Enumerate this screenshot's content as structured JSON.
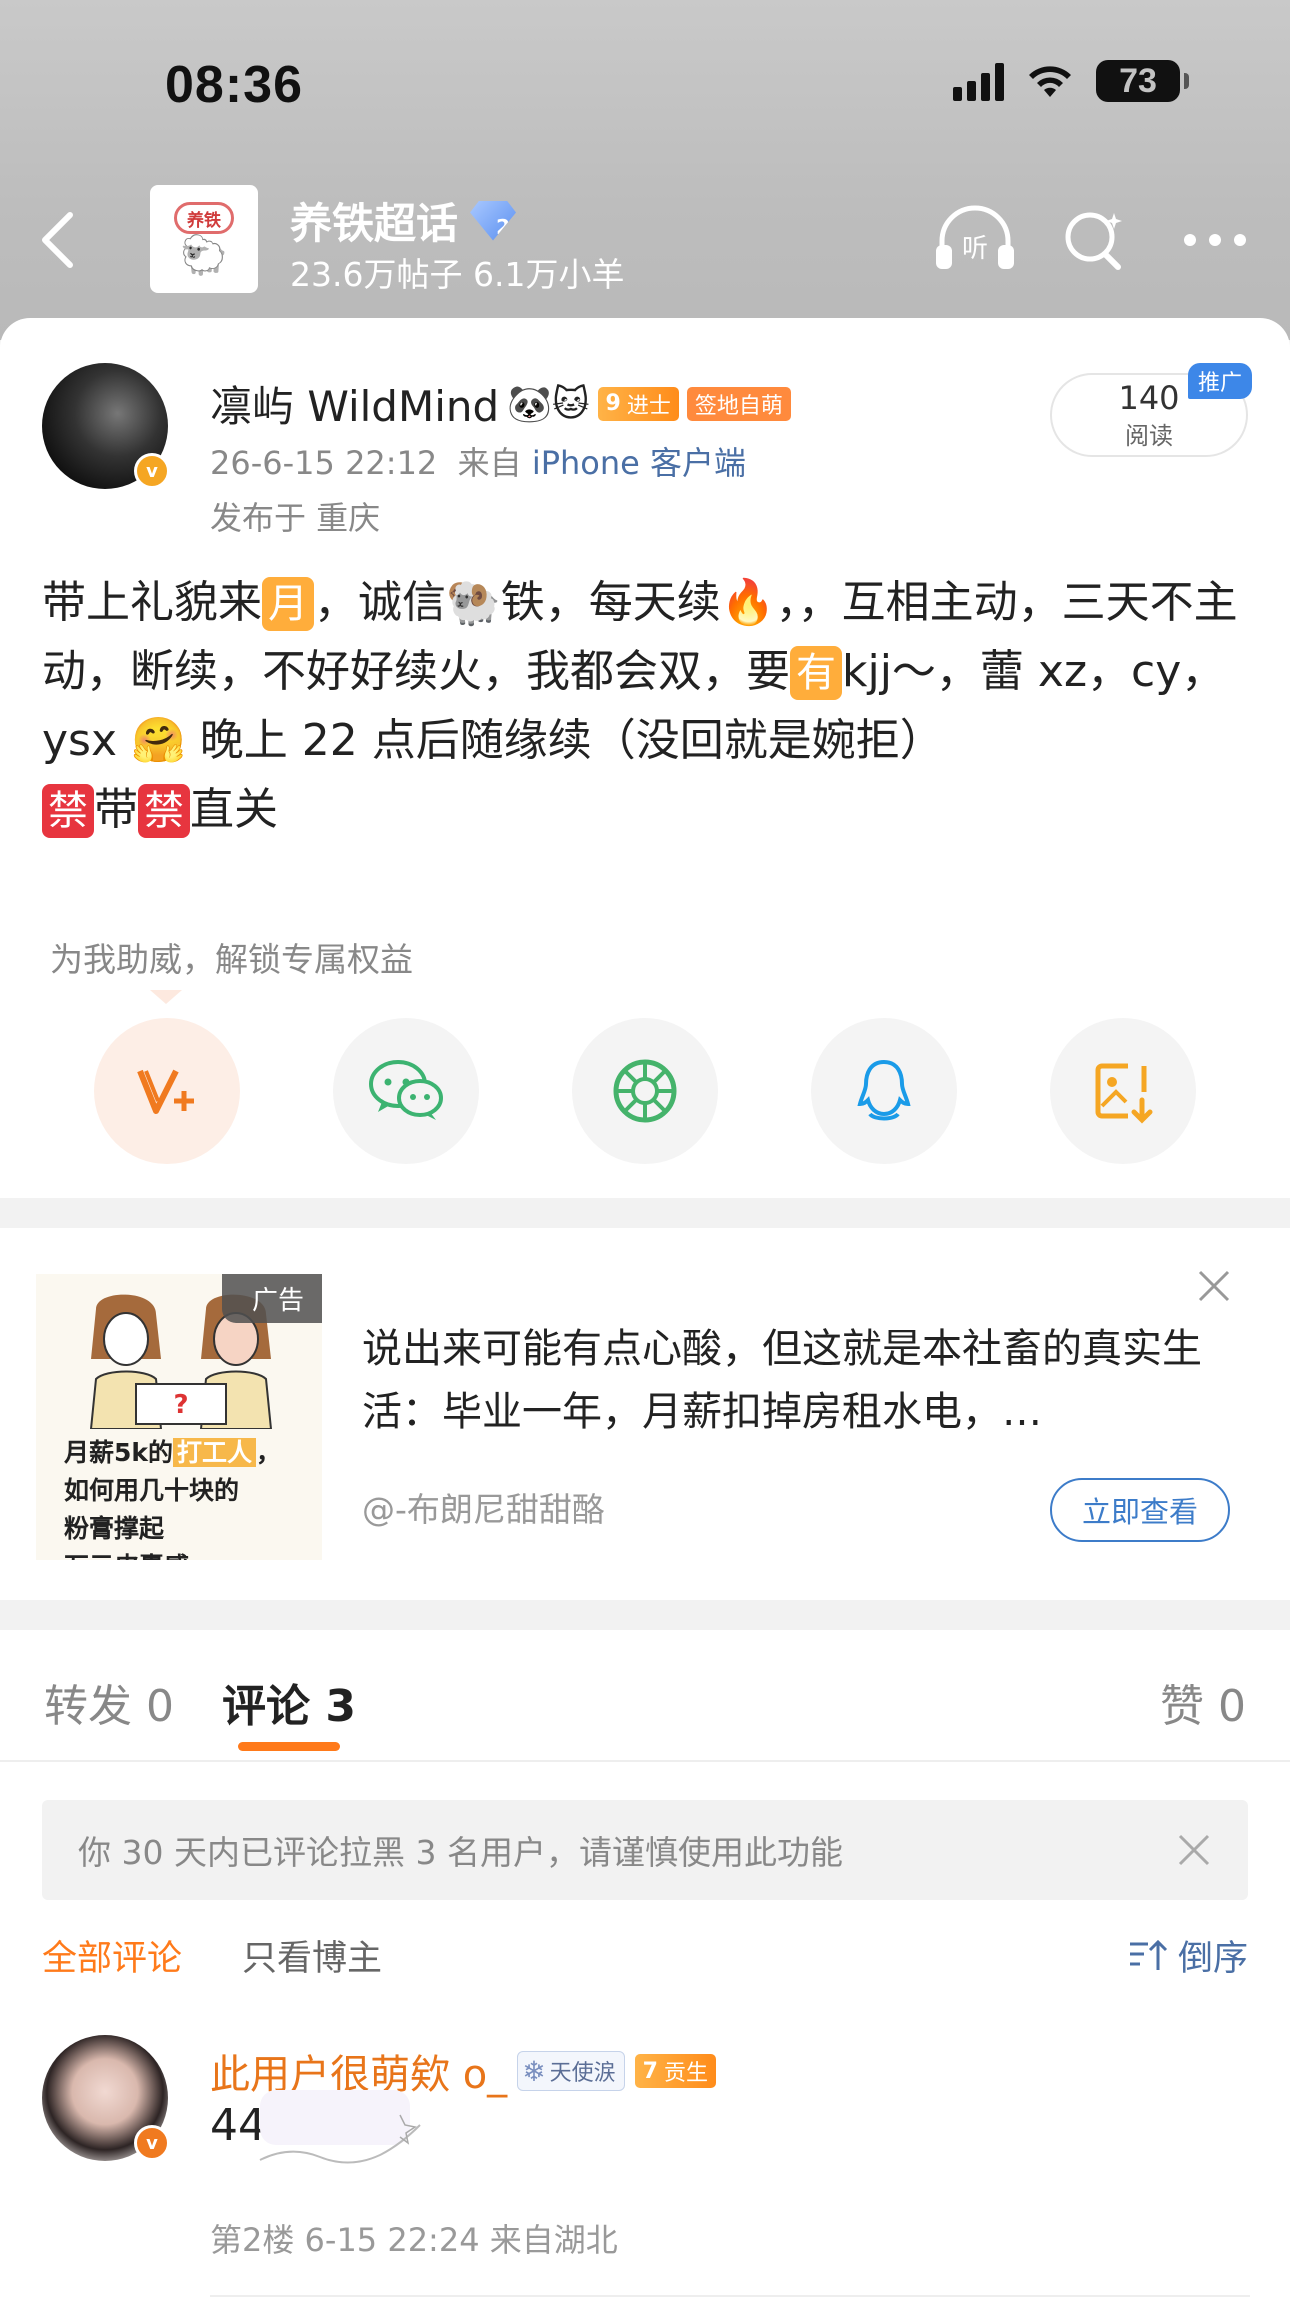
{
  "status_bar": {
    "time": "08:36",
    "battery": "73"
  },
  "topic": {
    "logo_text": "养铁",
    "name": "养铁超话",
    "level": "2",
    "stats": "23.6万帖子 6.1万小羊"
  },
  "post": {
    "author": "凛屿 WildMind",
    "author_emoji": "🐼🐱",
    "level_num": "9",
    "level_badge": "进士",
    "sign_badge": "签地自萌",
    "verified": "v",
    "time": "26-6-15 22:12",
    "from_prefix": "来自",
    "source": "iPhone 客户端",
    "location": "发布于 重庆",
    "reads": "140",
    "reads_label": "阅读",
    "promo_tag": "推广",
    "body": {
      "p1": "带上礼貌来",
      "tag_month": "月",
      "p2": "，诚信🐏铁，每天续🔥，，互相主动，三天不主动，断续，不好好续火，我都会双，要",
      "tag_have": "有",
      "p3": "kjj～，蕾 xz，cy，ysx 🤗 晚上 22 点后随缘续（没回就是婉拒）",
      "ban1": "禁",
      "p4": "带",
      "ban2": "禁",
      "p5": "直关"
    },
    "cheer_text": "为我助威，解锁专属权益",
    "share_icons": [
      "vip-support-icon",
      "wechat-icon",
      "moments-icon",
      "qq-icon",
      "save-image-icon"
    ]
  },
  "ad": {
    "label": "广告",
    "image_text_1": "月薪5k的",
    "image_text_hl": "打工人",
    "image_text_1_end": "，",
    "image_text_2": "如何用几十块的",
    "image_text_3": "粉膏撑起",
    "image_text_4": "万元皮囊感",
    "title": "说出来可能有点心酸，但这就是本社畜的真实生活：毕业一年，月薪扣掉房租水电，…",
    "author": "@-布朗尼甜甜酪",
    "cta": "立即查看"
  },
  "comments_section": {
    "tabs": [
      {
        "label": "转发",
        "count": "0"
      },
      {
        "label": "评论",
        "count": "3"
      },
      {
        "label": "赞",
        "count": "0"
      }
    ],
    "notice": "你 30 天内已评论拉黑 3 名用户，请谨慎使用此功能",
    "filter_all": "全部评论",
    "filter_author": "只看博主",
    "sort": "倒序",
    "items": [
      {
        "name": "此用户很萌欸 o_",
        "badge_angel": "天使涙",
        "level_num": "7",
        "badge_level": "贡生",
        "verified": "v",
        "text": "44",
        "meta": "第2楼 6-15 22:24 来自湖北"
      }
    ]
  },
  "colors": {
    "accent": "#ff7a1a",
    "link": "#4a6fa5",
    "tag": "#ffad3b",
    "ban": "#e7353f"
  }
}
